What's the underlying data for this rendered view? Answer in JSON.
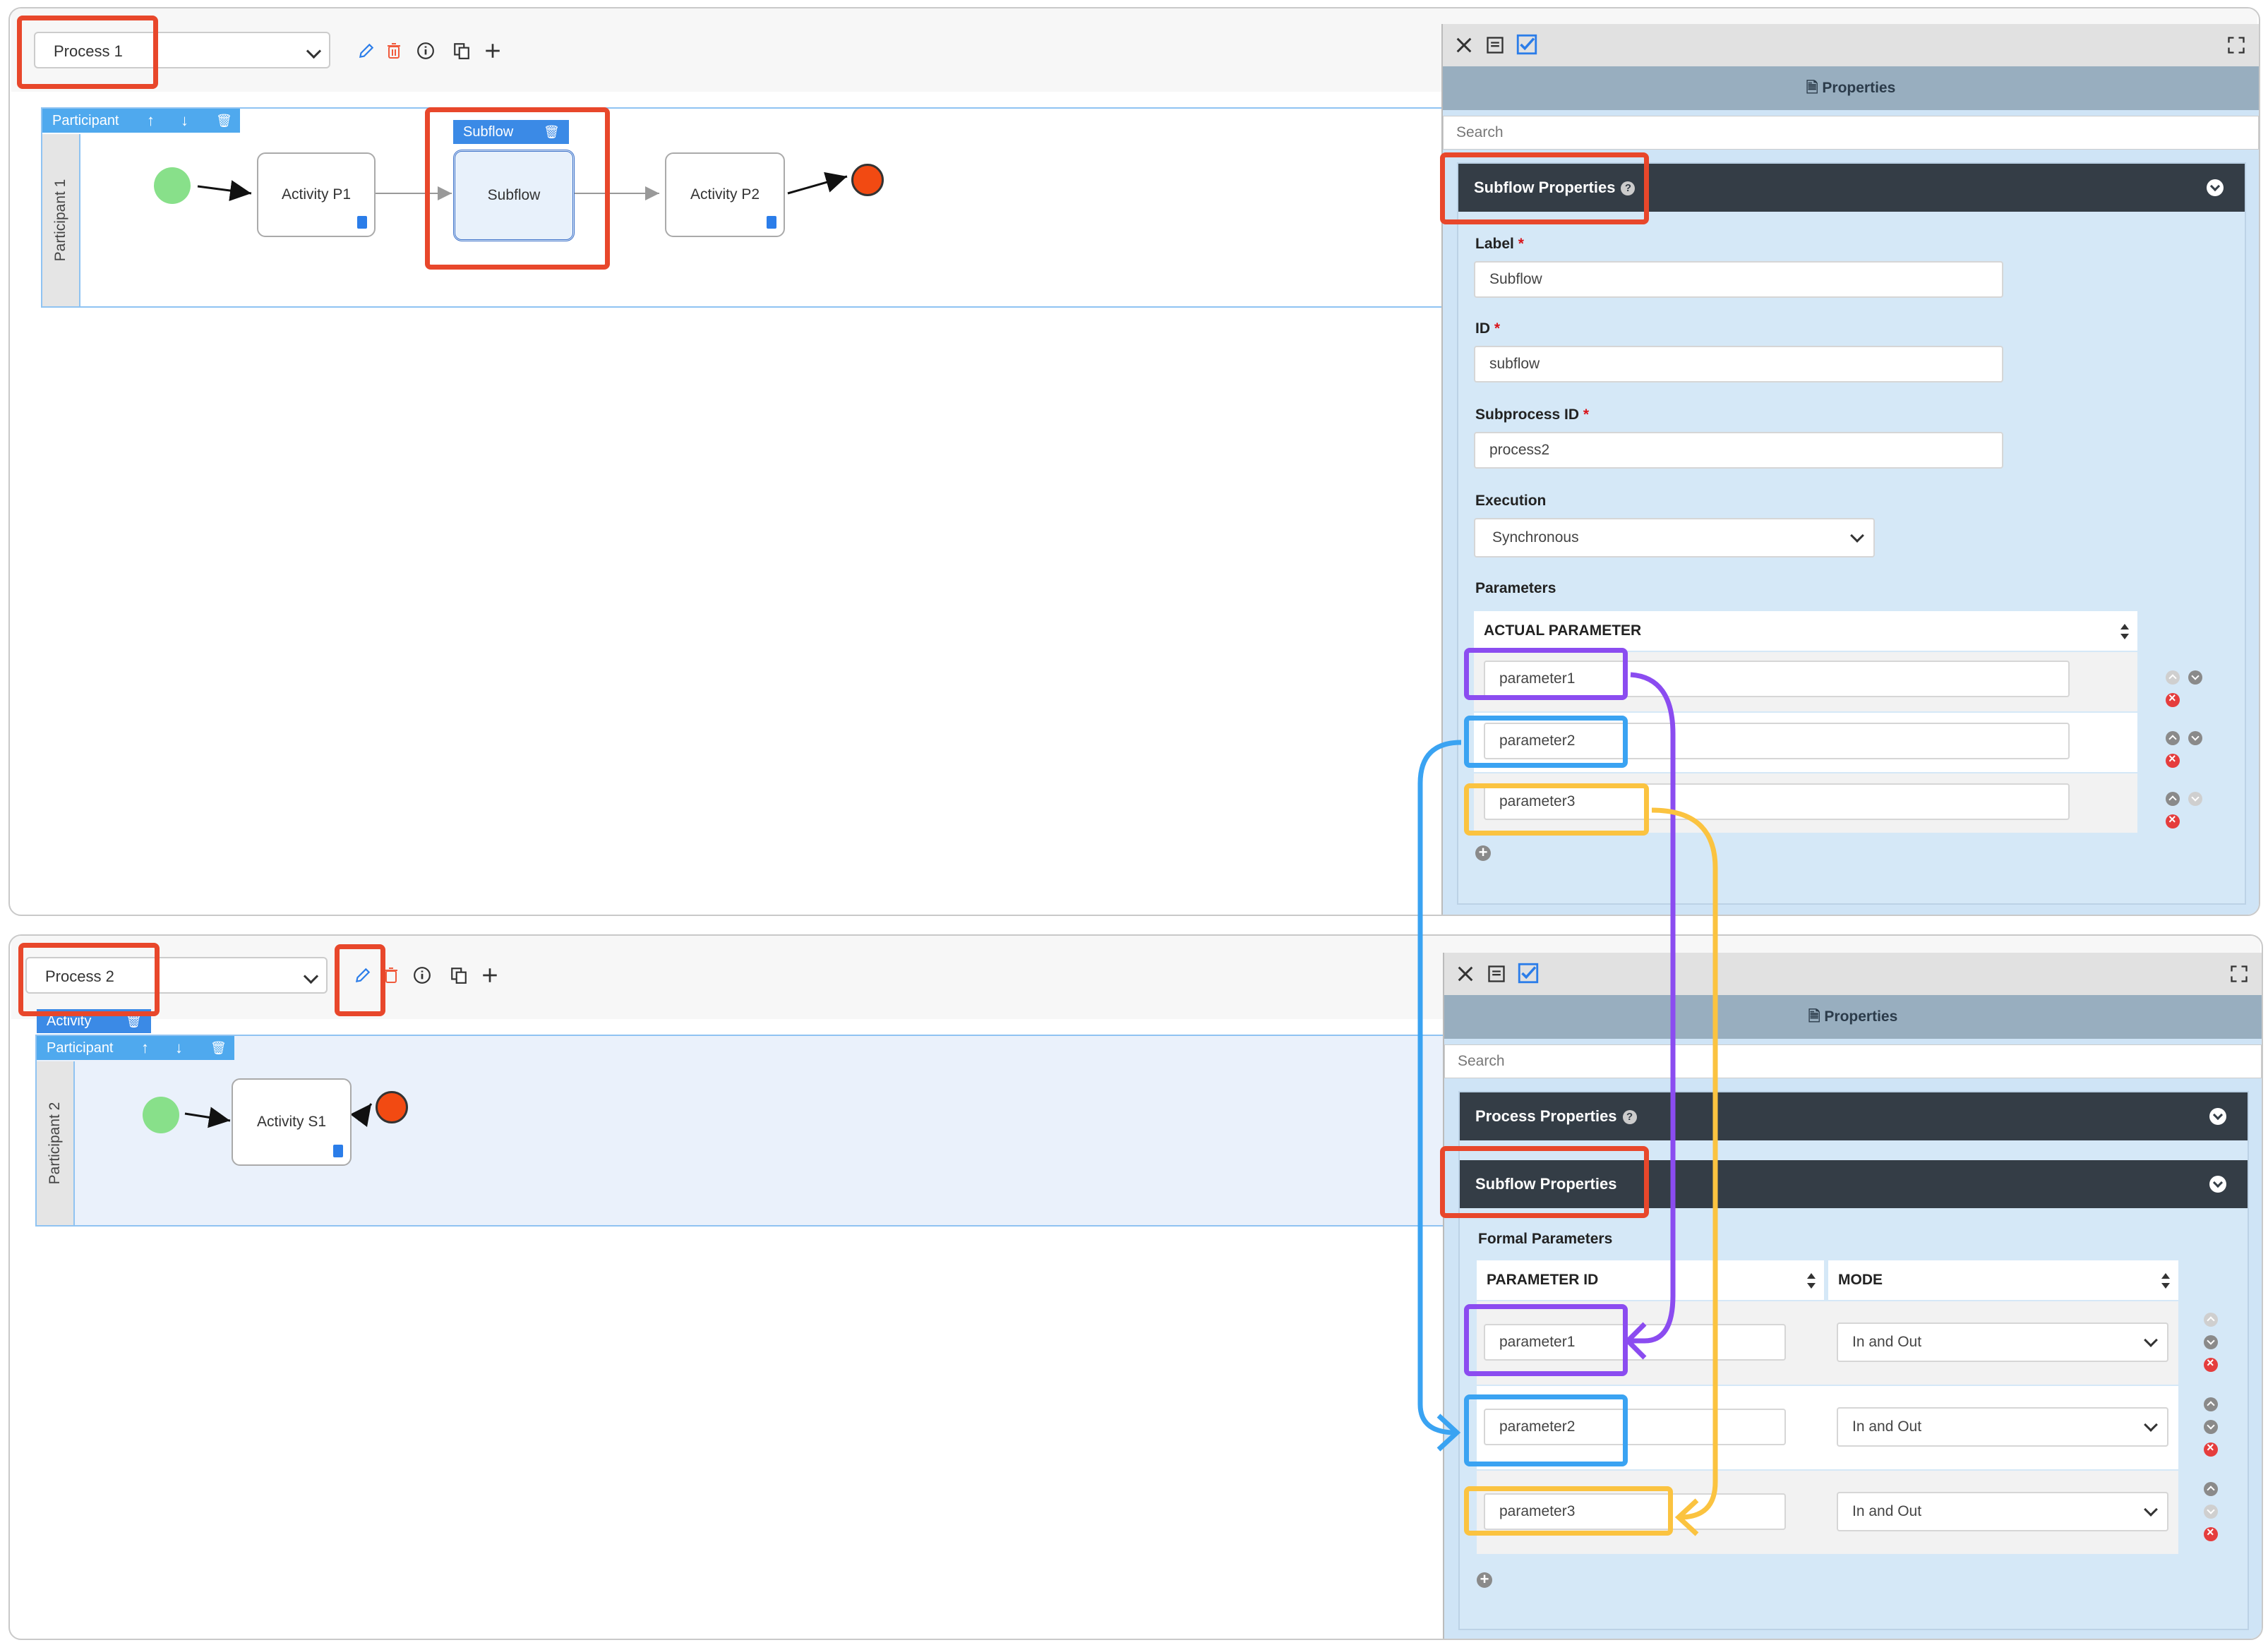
{
  "process1": {
    "selector_value": "Process 1",
    "participant_bar_label": "Participant",
    "lane_label": "Participant 1",
    "subflow_bar_label": "Subflow",
    "nodes": {
      "activity_p1": "Activity P1",
      "subflow": "Subflow",
      "activity_p2": "Activity P2"
    },
    "panel": {
      "title": "Properties",
      "search_placeholder": "Search",
      "section_title": "Subflow Properties",
      "fields": {
        "label_label": "Label",
        "label_value": "Subflow",
        "id_label": "ID",
        "id_value": "subflow",
        "subprocess_label": "Subprocess ID",
        "subprocess_value": "process2",
        "execution_label": "Execution",
        "execution_value": "Synchronous"
      },
      "parameters_label": "Parameters",
      "column_header": "ACTUAL PARAMETER",
      "rows": [
        "parameter1",
        "parameter2",
        "parameter3"
      ]
    }
  },
  "process2": {
    "selector_value": "Process 2",
    "activity_bar_label": "Activity",
    "participant_bar_label": "Participant",
    "lane_label": "Participant 2",
    "nodes": {
      "activity_s1": "Activity S1"
    },
    "panel": {
      "title": "Properties",
      "search_placeholder": "Search",
      "process_section_title": "Process Properties",
      "subflow_section_title": "Subflow Properties",
      "formal_parameters_label": "Formal Parameters",
      "col_param_id": "PARAMETER ID",
      "col_mode": "MODE",
      "rows": [
        {
          "id": "parameter1",
          "mode": "In and Out"
        },
        {
          "id": "parameter2",
          "mode": "In and Out"
        },
        {
          "id": "parameter3",
          "mode": "In and Out"
        }
      ]
    }
  },
  "colors": {
    "highlight_red": "#e8472b",
    "purple": "#8b4cf0",
    "blue": "#3aa3f2",
    "yellow": "#fbc340",
    "panel_blue": "#cfe4f6",
    "header_dark": "#343d46"
  }
}
